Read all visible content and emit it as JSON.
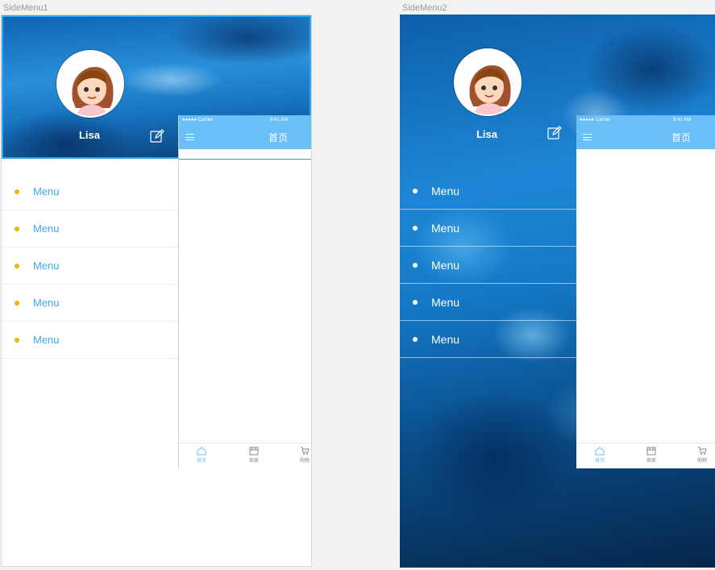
{
  "frames": {
    "frame1_label": "SideMenu1",
    "frame2_label": "SideMenu2"
  },
  "profile": {
    "name": "Lisa"
  },
  "menu": {
    "items": [
      "Menu",
      "Menu",
      "Menu",
      "Menu",
      "Menu"
    ]
  },
  "phone": {
    "carrier": "●●●●● Carrier",
    "time": "9:41 AM",
    "title": "首页",
    "tabs": [
      "首页",
      "商家",
      "购物"
    ]
  },
  "colors": {
    "accent": "#69bff8",
    "menu_text": "#3fa9ec",
    "bullet": "#f2b200",
    "selection": "#36a7ef"
  },
  "icons": {
    "edit": "edit-icon",
    "menu": "hamburger-icon",
    "home": "home-icon",
    "shop": "shop-icon",
    "cart": "cart-icon"
  }
}
